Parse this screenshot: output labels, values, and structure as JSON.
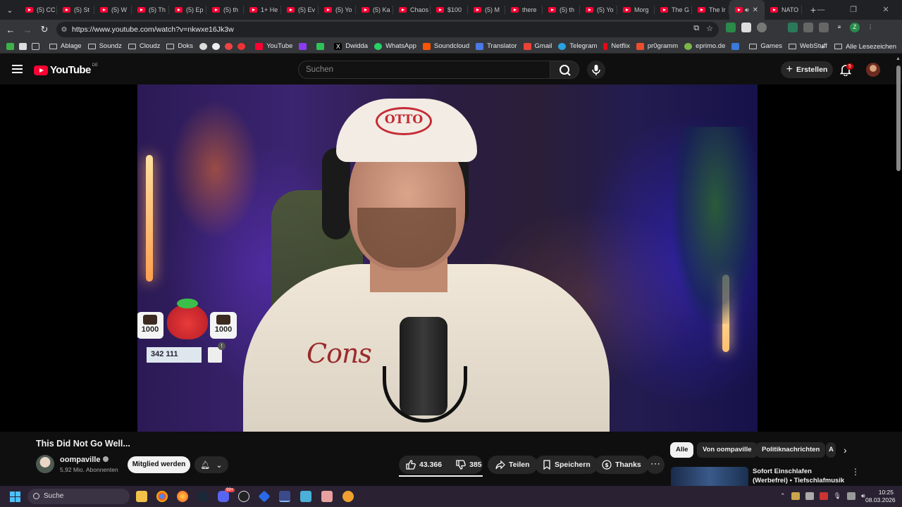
{
  "browser": {
    "tabs": [
      "(5) CC",
      "(5) St",
      "(5) W",
      "(5) Th",
      "(5) Ep",
      "(5) th",
      "1+ He",
      "(5) Ev",
      "(5) Yo",
      "(5) Ka",
      "Chaos",
      "$100",
      "(5) M",
      "there",
      "(5) th",
      "(5) Yo",
      "Morg",
      "The G",
      "The Ir",
      "",
      "NATO"
    ],
    "url": "https://www.youtube.com/watch?v=nkwxe16Jk3w",
    "bookmarks": [
      "Ablage",
      "Soundz",
      "Cloudz",
      "Doks",
      "YouTube",
      "Dwidda",
      "WhatsApp",
      "Soundcloud",
      "Translator",
      "Gmail",
      "Telegram",
      "Netflix",
      "pr0gramm",
      "eprimo.de",
      "Games",
      "WebStuff"
    ],
    "bookmark_more": "»",
    "all_bookmarks": "Alle Lesezeichen"
  },
  "youtube": {
    "logo_text": "YouTube",
    "country": "DE",
    "search_placeholder": "Suchen",
    "create_label": "Erstellen",
    "notifications": "5"
  },
  "overlay": {
    "left_count": "1000",
    "right_count": "1000",
    "counter": "342 111"
  },
  "shirt_text": "Cons",
  "cap_text": "OTTO",
  "video": {
    "title": "This Did Not Go Well...",
    "channel": "oompaville",
    "subscribers": "5,92 Mio. Abonnenten",
    "member_label": "Mitglied werden",
    "likes": "43.366",
    "dislikes": "385",
    "share_label": "Teilen",
    "save_label": "Speichern",
    "thanks_label": "Thanks"
  },
  "chips": [
    "Alle",
    "Von oompaville",
    "Politiknachrichten",
    "A"
  ],
  "recommendation": {
    "title": "Sofort Einschlafen (Werbefrei) • Tiefschlafmusik • Beruhigt ..."
  },
  "taskbar": {
    "search_label": "Suche",
    "time": "10:25",
    "date": "08.03.2026",
    "discord_badge": "99+"
  }
}
